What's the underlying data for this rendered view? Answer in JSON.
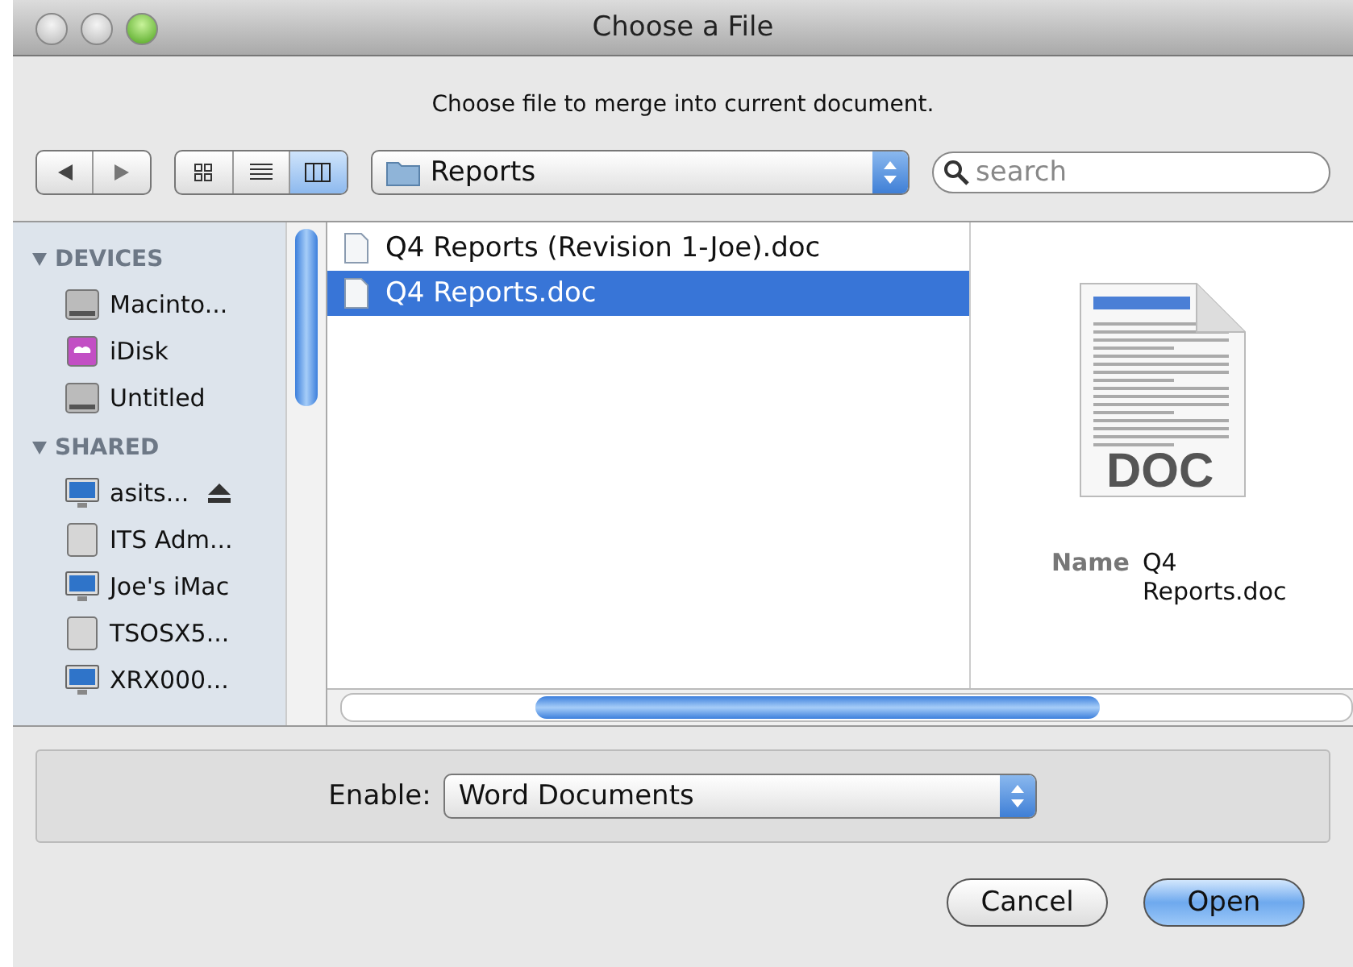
{
  "window": {
    "title": "Choose a File"
  },
  "message": "Choose file to merge into current document.",
  "view_modes": [
    {
      "kind": "icons",
      "selected": false
    },
    {
      "kind": "list",
      "selected": false
    },
    {
      "kind": "columns",
      "selected": true
    }
  ],
  "location": {
    "value": "Reports"
  },
  "search": {
    "placeholder": "search"
  },
  "sidebar": {
    "sections": [
      {
        "title": "DEVICES",
        "expanded": true,
        "items": [
          {
            "label": "Macinto...",
            "kind": "drive",
            "eject": false
          },
          {
            "label": "iDisk",
            "kind": "idisk",
            "eject": false
          },
          {
            "label": "Untitled",
            "kind": "drive",
            "eject": false
          }
        ]
      },
      {
        "title": "SHARED",
        "expanded": true,
        "items": [
          {
            "label": "asits...",
            "kind": "monitor",
            "eject": true
          },
          {
            "label": "ITS Adm...",
            "kind": "server",
            "eject": false
          },
          {
            "label": "Joe's iMac",
            "kind": "monitor",
            "eject": false
          },
          {
            "label": "TSOSX5...",
            "kind": "server",
            "eject": false
          },
          {
            "label": "XRX000...",
            "kind": "monitor",
            "eject": false
          }
        ]
      }
    ]
  },
  "files": [
    {
      "name": "Q4 Reports (Revision 1-Joe).doc",
      "selected": false
    },
    {
      "name": "Q4 Reports.doc",
      "selected": true
    }
  ],
  "preview": {
    "badge": "DOC",
    "name_label": "Name",
    "name_value": "Q4 Reports.doc"
  },
  "enable": {
    "label": "Enable:",
    "value": "Word Documents"
  },
  "buttons": [
    {
      "label": "Cancel",
      "default": false
    },
    {
      "label": "Open",
      "default": true
    }
  ]
}
